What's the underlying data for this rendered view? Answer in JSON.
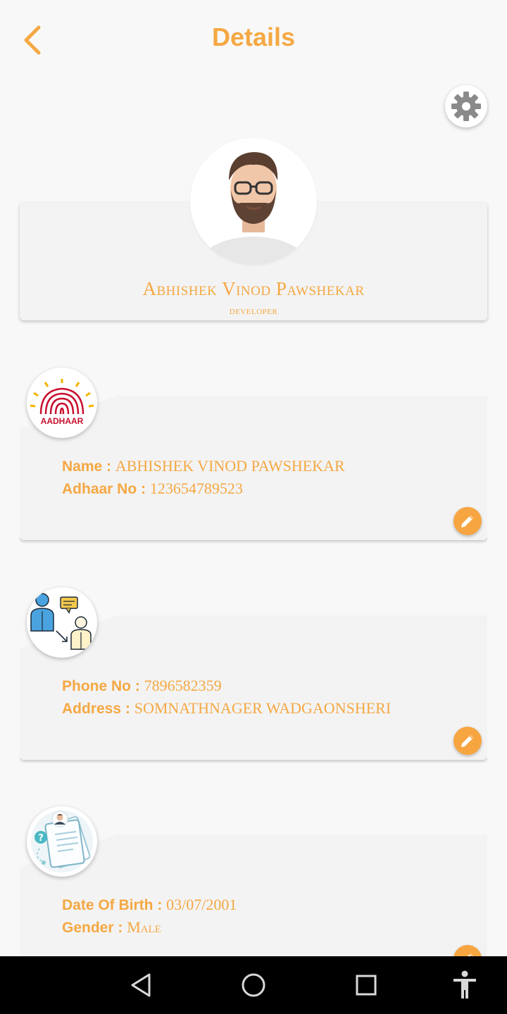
{
  "header": {
    "title": "Details"
  },
  "profile": {
    "name": "Abhishek Vinod Pawshekar",
    "role": "developer"
  },
  "cards": [
    {
      "icon": "aadhaar-logo-icon",
      "logo_text": "AADHAAR",
      "lines": [
        {
          "label": "Name : ",
          "value": "ABHISHEK VINOD PAWSHEKAR"
        },
        {
          "label": "Adhaar No : ",
          "value": "123654789523"
        }
      ]
    },
    {
      "icon": "contact-people-icon",
      "lines": [
        {
          "label": "Phone No : ",
          "value": "7896582359"
        },
        {
          "label": "Address : ",
          "value": "SOMNATHNAGER WADGAONSHERI"
        }
      ]
    },
    {
      "icon": "personal-document-icon",
      "lines": [
        {
          "label": "Date Of Birth : ",
          "value": "03/07/2001"
        },
        {
          "label": "Gender : ",
          "value": "Male"
        }
      ]
    }
  ],
  "colors": {
    "accent": "#f5a843",
    "background": "#f8f8f8",
    "card": "#f3f3f3",
    "nav": "#000000"
  },
  "nav": {
    "buttons": [
      "back-triangle-icon",
      "home-circle-icon",
      "recents-square-icon",
      "accessibility-icon"
    ]
  }
}
